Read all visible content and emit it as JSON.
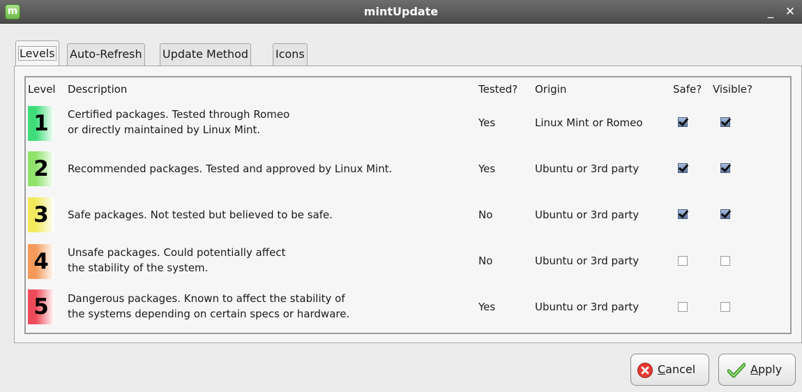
{
  "window": {
    "title": "mintUpdate"
  },
  "tabs": [
    {
      "label": "Levels"
    },
    {
      "label": "Auto-Refresh"
    },
    {
      "label": "Update Method"
    },
    {
      "label": "Icons"
    }
  ],
  "table": {
    "headers": {
      "level": "Level",
      "description": "Description",
      "tested": "Tested?",
      "origin": "Origin",
      "safe": "Safe?",
      "visible": "Visible?"
    },
    "rows": [
      {
        "level": "1",
        "color": "#3fdc7a",
        "desc1": "Certified packages. Tested through Romeo",
        "desc2": "or directly maintained by Linux Mint.",
        "tested": "Yes",
        "origin": "Linux Mint or Romeo",
        "safe": true,
        "visible": true
      },
      {
        "level": "2",
        "color": "#8fe36b",
        "desc1": "Recommended packages. Tested and approved by Linux Mint.",
        "desc2": "",
        "tested": "Yes",
        "origin": "Ubuntu or 3rd party",
        "safe": true,
        "visible": true
      },
      {
        "level": "3",
        "color": "#f2ea5c",
        "desc1": "Safe packages. Not tested but believed to be safe.",
        "desc2": "",
        "tested": "No",
        "origin": "Ubuntu or 3rd party",
        "safe": true,
        "visible": true
      },
      {
        "level": "4",
        "color": "#f59a5a",
        "desc1": "Unsafe packages. Could potentially affect",
        "desc2": "the stability of the system.",
        "tested": "No",
        "origin": "Ubuntu or 3rd party",
        "safe": false,
        "visible": false
      },
      {
        "level": "5",
        "color": "#ee4b5a",
        "desc1": "Dangerous packages. Known to affect the stability of",
        "desc2": "the  systems depending on certain specs or hardware.",
        "tested": "Yes",
        "origin": "Ubuntu or 3rd party",
        "safe": false,
        "visible": false
      }
    ]
  },
  "buttons": {
    "cancel_mnemonic": "C",
    "cancel_rest": "ancel",
    "apply_mnemonic": "A",
    "apply_rest": "pply"
  }
}
